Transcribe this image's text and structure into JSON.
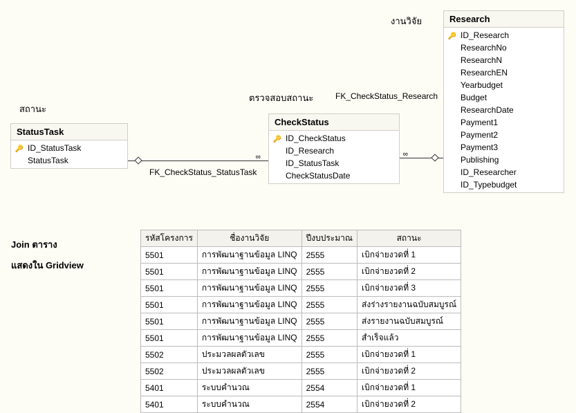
{
  "labels": {
    "status": "สถานะ",
    "checkstatus": "ตรวจสอบสถานะ",
    "research": "งานวิจัย",
    "join_caption_l1": "Join ตาราง",
    "join_caption_l2": "แสดงใน Gridview",
    "fk1": "FK_CheckStatus_StatusTask",
    "fk2": "FK_CheckStatus_Research"
  },
  "tables": {
    "statusTask": {
      "title": "StatusTask",
      "fields": [
        {
          "name": "ID_StatusTask",
          "pk": true
        },
        {
          "name": "StatusTask",
          "pk": false
        }
      ]
    },
    "checkStatus": {
      "title": "CheckStatus",
      "fields": [
        {
          "name": "ID_CheckStatus",
          "pk": true
        },
        {
          "name": "ID_Research",
          "pk": false
        },
        {
          "name": "ID_StatusTask",
          "pk": false
        },
        {
          "name": "CheckStatusDate",
          "pk": false
        }
      ]
    },
    "research": {
      "title": "Research",
      "fields": [
        {
          "name": "ID_Research",
          "pk": true
        },
        {
          "name": "ResearchNo",
          "pk": false
        },
        {
          "name": "ResearchN",
          "pk": false
        },
        {
          "name": "ResearchEN",
          "pk": false
        },
        {
          "name": "Yearbudget",
          "pk": false
        },
        {
          "name": "Budget",
          "pk": false
        },
        {
          "name": "ResearchDate",
          "pk": false
        },
        {
          "name": "Payment1",
          "pk": false
        },
        {
          "name": "Payment2",
          "pk": false
        },
        {
          "name": "Payment3",
          "pk": false
        },
        {
          "name": "Publishing",
          "pk": false
        },
        {
          "name": "ID_Researcher",
          "pk": false
        },
        {
          "name": "ID_Typebudget",
          "pk": false
        }
      ]
    }
  },
  "grid": {
    "headers": [
      "รหัสโครงการ",
      "ชื่องานวิจัย",
      "ปีงบประมาณ",
      "สถานะ"
    ],
    "rows": [
      [
        "5501",
        "การพัฒนาฐานข้อมูล LINQ",
        "2555",
        "เบิกจ่ายงวดที่ 1"
      ],
      [
        "5501",
        "การพัฒนาฐานข้อมูล LINQ",
        "2555",
        "เบิกจ่ายงวดที่ 2"
      ],
      [
        "5501",
        "การพัฒนาฐานข้อมูล LINQ",
        "2555",
        "เบิกจ่ายงวดที่ 3"
      ],
      [
        "5501",
        "การพัฒนาฐานข้อมูล LINQ",
        "2555",
        "ส่งร่างรายงานฉบับสมบูรณ์"
      ],
      [
        "5501",
        "การพัฒนาฐานข้อมูล LINQ",
        "2555",
        "ส่งรายงานฉบับสมบูรณ์"
      ],
      [
        "5501",
        "การพัฒนาฐานข้อมูล LINQ",
        "2555",
        "สำเร็จแล้ว"
      ],
      [
        "5502",
        "ประมวลผลตัวเลข",
        "2555",
        "เบิกจ่ายงวดที่ 1"
      ],
      [
        "5502",
        "ประมวลผลตัวเลข",
        "2555",
        "เบิกจ่ายงวดที่ 2"
      ],
      [
        "5401",
        "ระบบคำนวณ",
        "2554",
        "เบิกจ่ายงวดที่ 1"
      ],
      [
        "5401",
        "ระบบคำนวณ",
        "2554",
        "เบิกจ่ายงวดที่ 2"
      ]
    ]
  }
}
